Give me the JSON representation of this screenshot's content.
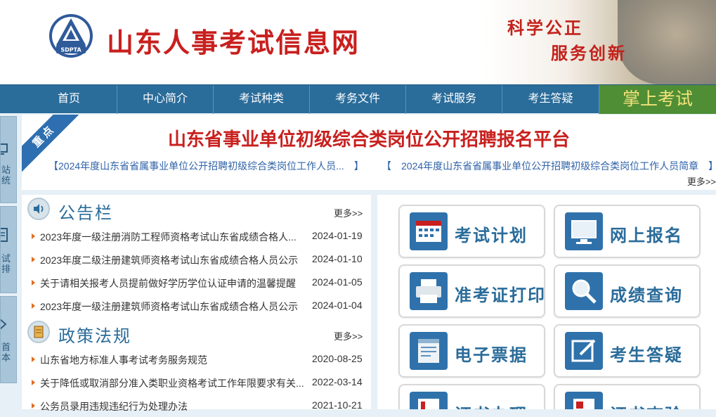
{
  "header": {
    "logo_text": "SDPTA",
    "site_title": "山东人事考试信息网",
    "slogan_line1": "科学公正",
    "slogan_line2": "服务创新"
  },
  "nav": {
    "items": [
      "首页",
      "中心简介",
      "考试种类",
      "考务文件",
      "考试服务",
      "考生答疑"
    ],
    "highlight": "掌上考试"
  },
  "side_float": {
    "items": [
      "站\n统",
      "试\n排",
      "首\n本"
    ]
  },
  "headline": {
    "ribbon": "重点",
    "title": "山东省事业单位初级综合类岗位公开招聘报名平台",
    "links": [
      "【2024年度山东省省属事业单位公开招聘初级综合类岗位工作人员...　】",
      "【　2024年度山东省省属事业单位公开招聘初级综合类岗位工作人员简章　】"
    ],
    "more": "更多>>"
  },
  "notice": {
    "title": "公告栏",
    "icon": "speaker-icon",
    "more": "更多>>",
    "items": [
      {
        "title": "2023年度一级注册消防工程师资格考试山东省成绩合格人...",
        "date": "2024-01-19"
      },
      {
        "title": "2023年度二级注册建筑师资格考试山东省成绩合格人员公示",
        "date": "2024-01-10"
      },
      {
        "title": "关于请相关报考人员提前做好学历学位认证申请的温馨提醒",
        "date": "2024-01-05"
      },
      {
        "title": "2023年度一级注册建筑师资格考试山东省成绩合格人员公示",
        "date": "2024-01-04"
      }
    ]
  },
  "policy": {
    "title": "政策法规",
    "icon": "document-icon",
    "more": "更多>>",
    "items": [
      {
        "title": "山东省地方标准人事考试考务服务规范",
        "date": "2020-08-25"
      },
      {
        "title": "关于降低或取消部分准入类职业资格考试工作年限要求有关...",
        "date": "2022-03-14"
      },
      {
        "title": "公务员录用违规违纪行为处理办法",
        "date": "2021-10-21"
      }
    ]
  },
  "services": {
    "tiles": [
      {
        "label": "考试计划",
        "icon": "calendar-icon"
      },
      {
        "label": "网上报名",
        "icon": "monitor-icon"
      },
      {
        "label": "准考证打印",
        "icon": "printer-icon"
      },
      {
        "label": "成绩查询",
        "icon": "magnifier-icon"
      },
      {
        "label": "电子票据",
        "icon": "receipt-icon"
      },
      {
        "label": "考生答疑",
        "icon": "edit-icon"
      },
      {
        "label": "证书办理",
        "icon": "certificate-icon"
      },
      {
        "label": "证书查验",
        "icon": "certificate-check-icon"
      }
    ]
  },
  "colors": {
    "brand_red": "#c8201e",
    "nav_blue": "#2a6c9a",
    "nav_green": "#4f8e35",
    "link_blue": "#2f63a8",
    "bullet_orange": "#e06b20"
  }
}
